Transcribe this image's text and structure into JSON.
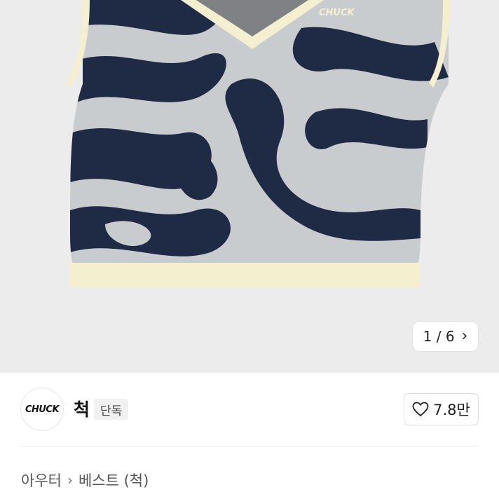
{
  "gallery": {
    "logo_text": "CHUCK",
    "counter": {
      "text": "1 / 6",
      "icon": "chevron-right-icon"
    }
  },
  "brand": {
    "logo_text": "CHUCK",
    "name": "척",
    "badge": "단독",
    "likes": "7.8만",
    "like_icon": "heart-outline-icon"
  },
  "breadcrumb": {
    "items": [
      "아우터",
      "베스트 (척)"
    ],
    "separator": "›"
  },
  "colors": {
    "gallery_bg": "#ececec",
    "vest_navy": "#1f2a44",
    "vest_grey": "#c9cccf",
    "vest_trim": "#f3efcf"
  }
}
